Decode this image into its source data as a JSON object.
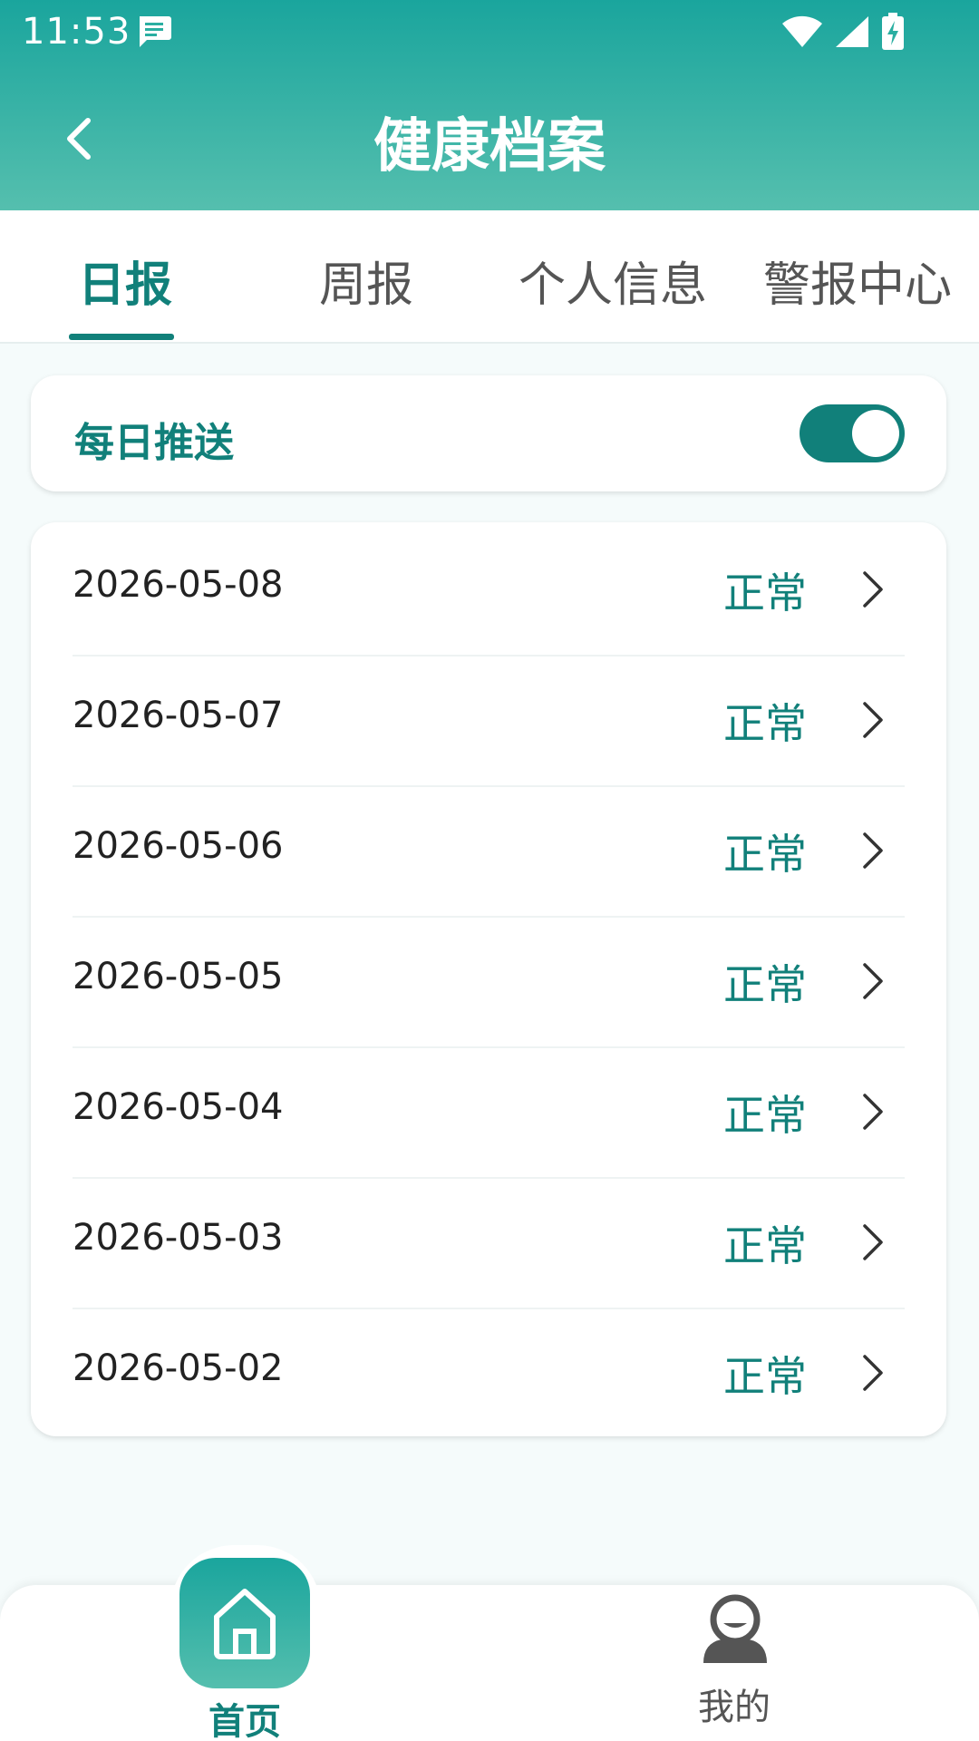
{
  "status_bar": {
    "time": "11:53",
    "icons": [
      "message-icon",
      "wifi-icon",
      "signal-icon",
      "battery-charging-icon"
    ]
  },
  "header": {
    "title": "健康档案",
    "back_icon": "chevron-left-icon"
  },
  "tabs": [
    {
      "label": "日报",
      "active": true
    },
    {
      "label": "周报",
      "active": false
    },
    {
      "label": "个人信息",
      "active": false
    },
    {
      "label": "警报中心",
      "active": false
    }
  ],
  "daily_push": {
    "label": "每日推送",
    "enabled": true
  },
  "reports": [
    {
      "date": "2026-05-08",
      "status": "正常"
    },
    {
      "date": "2026-05-07",
      "status": "正常"
    },
    {
      "date": "2026-05-06",
      "status": "正常"
    },
    {
      "date": "2026-05-05",
      "status": "正常"
    },
    {
      "date": "2026-05-04",
      "status": "正常"
    },
    {
      "date": "2026-05-03",
      "status": "正常"
    },
    {
      "date": "2026-05-02",
      "status": "正常"
    }
  ],
  "bottom_nav": {
    "home_label": "首页",
    "home_icon": "home-icon",
    "mine_label": "我的",
    "mine_icon": "user-icon"
  },
  "colors": {
    "accent": "#11807a",
    "header_top": "#1aa59d",
    "header_bottom": "#55bfae",
    "background": "#f5fbfb"
  }
}
